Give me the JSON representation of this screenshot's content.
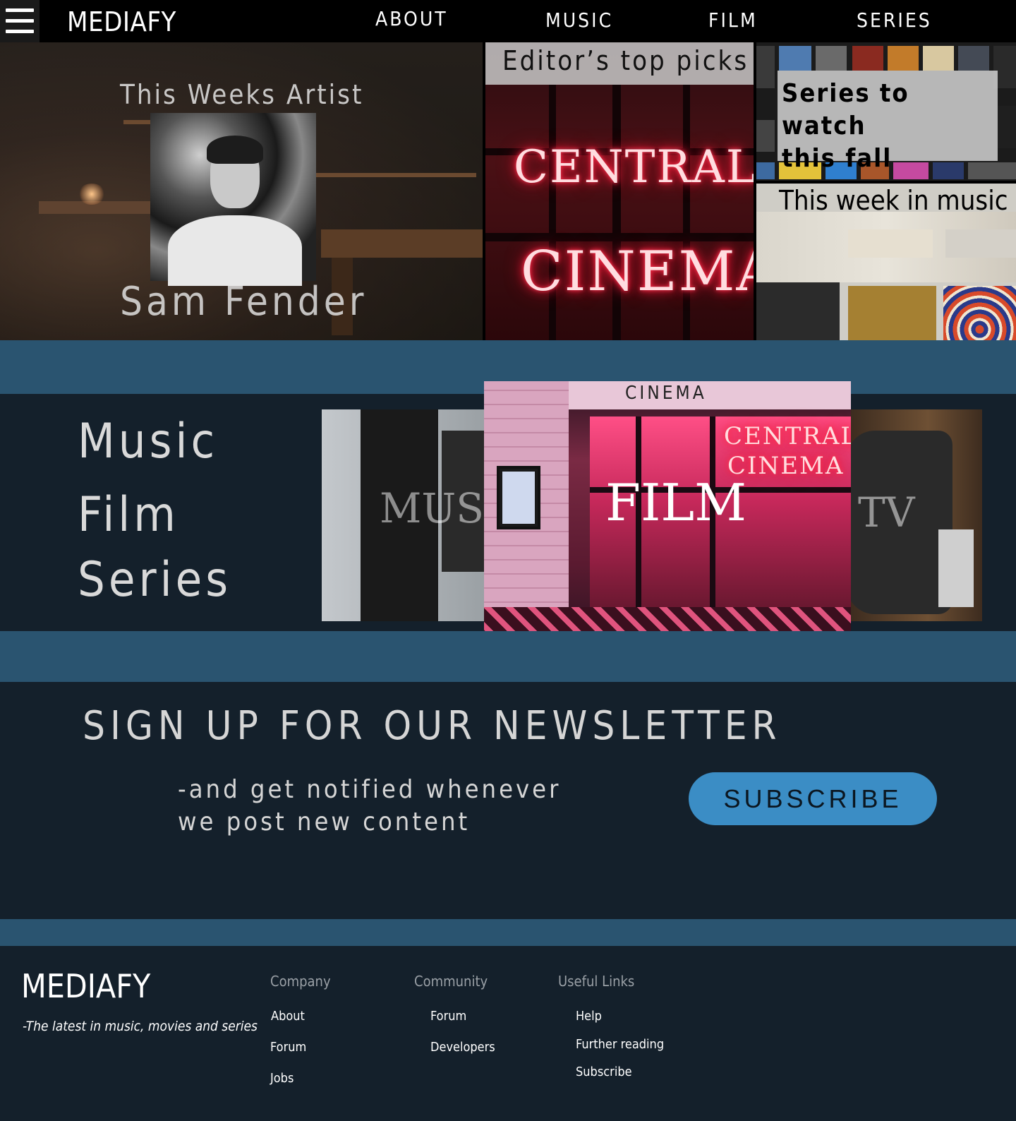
{
  "nav": {
    "logo": "MEDIAFY",
    "links": [
      "ABOUT",
      "MUSIC",
      "FILM",
      "SERIES"
    ]
  },
  "hero": {
    "artist_title": "This Weeks Artist",
    "artist_name": "Sam Fender",
    "picks_label": "Editor’s top picks",
    "picks_neon": [
      "CENTRAL",
      "CINEMA"
    ],
    "series_label_line1": "Series to watch",
    "series_label_line2": "this fall",
    "music_label": "This week in music"
  },
  "categories": {
    "links": [
      "Music",
      "Film",
      "Series"
    ],
    "slides": {
      "music": "MUSIC",
      "film": "FILM",
      "tv": "TV",
      "film_sign_top": "CINEMA",
      "film_neon": [
        "CENTRAL",
        "CINEMA"
      ]
    }
  },
  "newsletter": {
    "title": "SIGN UP FOR OUR NEWSLETTER",
    "sub_line1": "-and get notified whenever",
    "sub_line2": "we post new content",
    "button": "SUBSCRIBE"
  },
  "footer": {
    "logo": "MEDIAFY",
    "tagline": "-The latest in music, movies and series",
    "columns": [
      {
        "heading": "Company",
        "links": [
          "About",
          "Forum",
          "Jobs"
        ]
      },
      {
        "heading": "Community",
        "links": [
          "Forum",
          "Developers"
        ]
      },
      {
        "heading": "Useful Links",
        "links": [
          "Help",
          "Further reading",
          "Subscribe"
        ]
      }
    ]
  },
  "colors": {
    "nav_bg": "#000000",
    "band_blue": "#2a5470",
    "dark_bg": "#14202b",
    "button_blue": "#3b8dc5"
  }
}
